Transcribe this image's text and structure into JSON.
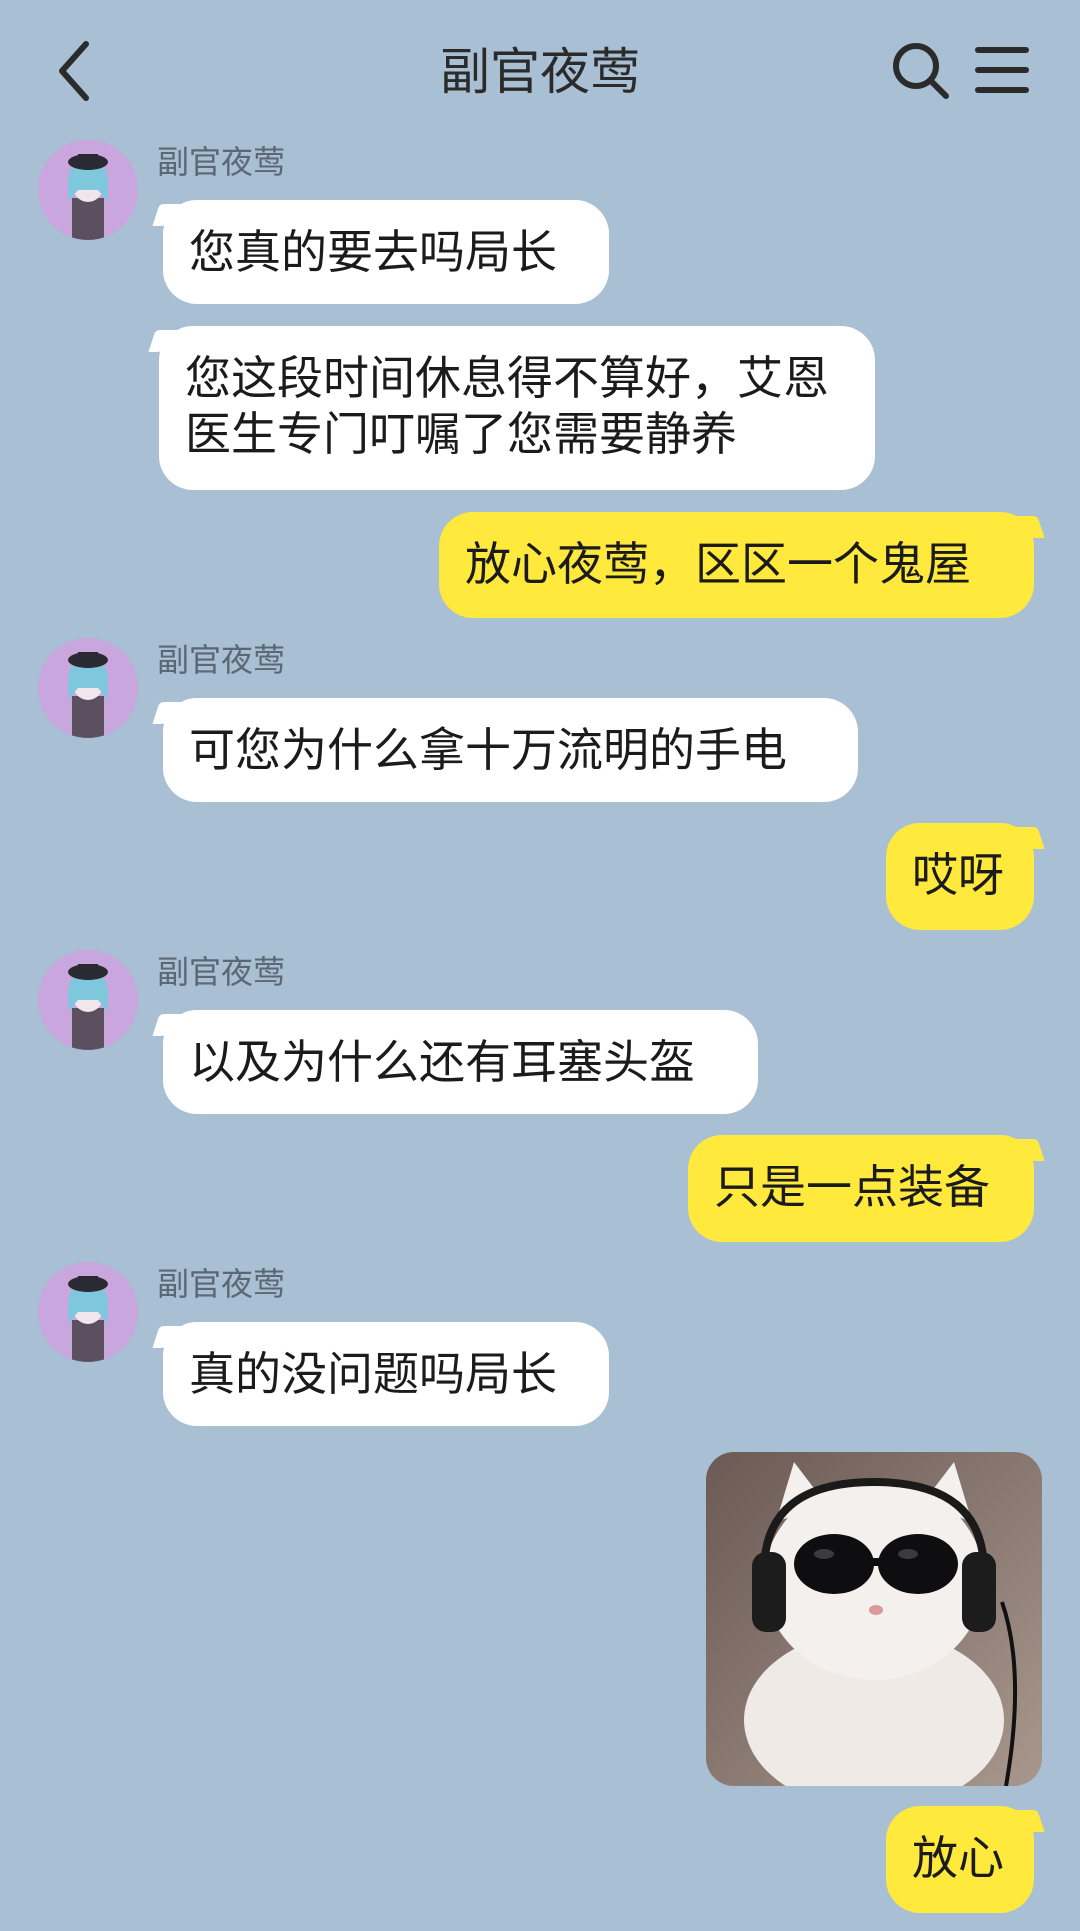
{
  "header": {
    "title": "副官夜莺",
    "back_icon": "chevron-left-icon",
    "search_icon": "search-icon",
    "menu_icon": "menu-icon"
  },
  "contact": {
    "name": "副官夜莺",
    "avatar_bg": "#c9a6dd"
  },
  "colors": {
    "background": "#a9bfd3",
    "incoming_bubble": "#ffffff",
    "outgoing_bubble": "#ffe93d"
  },
  "messages": [
    {
      "side": "in",
      "sender": "副官夜莺",
      "text": "您真的要去吗局长"
    },
    {
      "side": "in",
      "text": "您这段时间休息得不算好，艾恩医生专门叮嘱了您需要静养"
    },
    {
      "side": "out",
      "text": "放心夜莺，区区一个鬼屋"
    },
    {
      "side": "in",
      "sender": "副官夜莺",
      "text": "可您为什么拿十万流明的手电"
    },
    {
      "side": "out",
      "text": "哎呀"
    },
    {
      "side": "in",
      "sender": "副官夜莺",
      "text": "以及为什么还有耳塞头盔"
    },
    {
      "side": "out",
      "text": "只是一点装备"
    },
    {
      "side": "in",
      "sender": "副官夜莺",
      "text": "真的没问题吗局长"
    },
    {
      "side": "out",
      "type": "sticker",
      "description_icon": "cat-with-sunglasses-sticker"
    },
    {
      "side": "out",
      "text": "放心"
    }
  ]
}
